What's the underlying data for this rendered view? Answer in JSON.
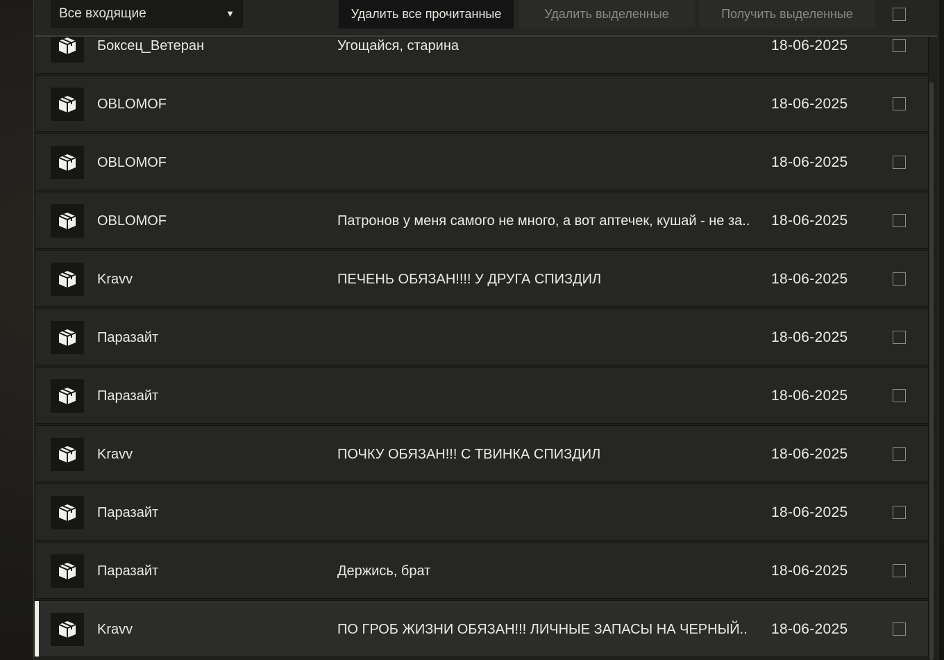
{
  "toolbar": {
    "filter_value": "Все входящие",
    "delete_read_label": "Удалить все прочитанные",
    "delete_selected_label": "Удалить выделенные",
    "receive_selected_label": "Получить выделенные"
  },
  "icons": {
    "row_icon": "package-box-icon",
    "dropdown_arrow": "▼"
  },
  "colors": {
    "background": "#1f1f1e",
    "row": "#262624",
    "text": "#ebe9e3",
    "disabled_text": "#8a8884",
    "selected_marker": "#efece4"
  },
  "messages": [
    {
      "sender": "Боксец_Ветеран",
      "subject": "Угощайся, старина",
      "date": "18-06-2025"
    },
    {
      "sender": "OBLOMOF",
      "subject": "",
      "date": "18-06-2025"
    },
    {
      "sender": "OBLOMOF",
      "subject": "",
      "date": "18-06-2025"
    },
    {
      "sender": "OBLOMOF",
      "subject": "Патронов у меня самого не много, а вот аптечек, кушай - не за..",
      "date": "18-06-2025"
    },
    {
      "sender": "Kravv",
      "subject": "ПЕЧЕНЬ ОБЯЗАН!!!! У ДРУГА СПИЗДИЛ",
      "date": "18-06-2025"
    },
    {
      "sender": "Паразайт",
      "subject": "",
      "date": "18-06-2025"
    },
    {
      "sender": "Паразайт",
      "subject": "",
      "date": "18-06-2025"
    },
    {
      "sender": "Kravv",
      "subject": "ПОЧКУ ОБЯЗАН!!! С ТВИНКА СПИЗДИЛ",
      "date": "18-06-2025"
    },
    {
      "sender": "Паразайт",
      "subject": "",
      "date": "18-06-2025"
    },
    {
      "sender": "Паразайт",
      "subject": "Держись, брат",
      "date": "18-06-2025"
    },
    {
      "sender": "Kravv",
      "subject": "ПО ГРОБ ЖИЗНИ ОБЯЗАН!!! ЛИЧНЫЕ ЗАПАСЫ НА ЧЕРНЫЙ..",
      "date": "18-06-2025"
    }
  ]
}
